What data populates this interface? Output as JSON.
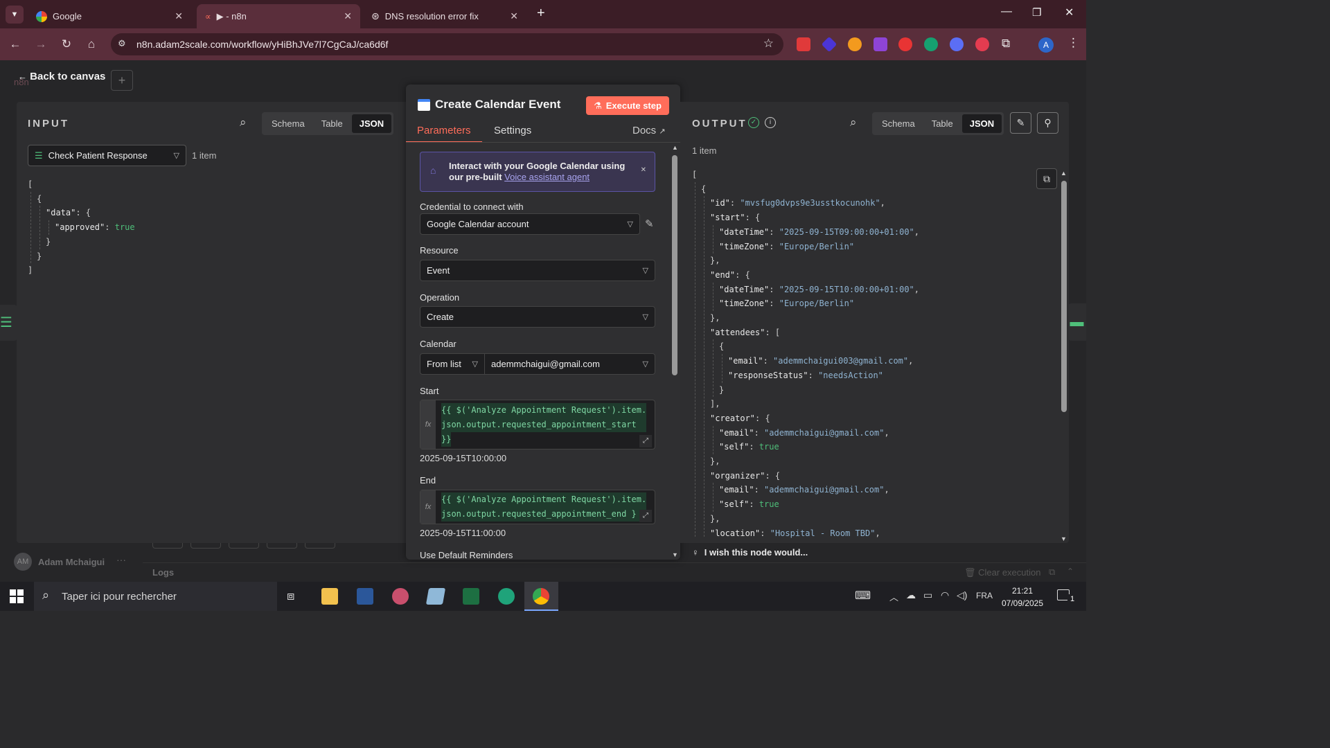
{
  "browser": {
    "tabs": [
      {
        "title": "Google",
        "active": false
      },
      {
        "title": "▶ - n8n",
        "active": true
      },
      {
        "title": "DNS resolution error fix",
        "active": false
      }
    ],
    "url": "n8n.adam2scale.com/workflow/yHiBhJVe7l7CgCaJ/ca6d6f",
    "profile_initial": "A"
  },
  "canvas": {
    "back_label": "Back to canvas",
    "logo_text": "n8n",
    "user_initials": "AM",
    "user_name": "Adam Mchaigui",
    "logs_label": "Logs",
    "clear_execution": "Clear execution"
  },
  "input": {
    "title": "INPUT",
    "views": [
      "Schema",
      "Table",
      "JSON"
    ],
    "active_view": "JSON",
    "node_select": "Check Patient Response",
    "item_count": "1 item"
  },
  "node": {
    "title": "Create Calendar Event",
    "execute_label": "Execute step",
    "tabs": {
      "parameters": "Parameters",
      "settings": "Settings",
      "docs": "Docs"
    },
    "banner_text": "Interact with your Google Calendar using our pre-built",
    "banner_link": "Voice assistant agent",
    "credential_label": "Credential to connect with",
    "credential_value": "Google Calendar account",
    "resource_label": "Resource",
    "resource_value": "Event",
    "operation_label": "Operation",
    "operation_value": "Create",
    "calendar_label": "Calendar",
    "calendar_mode": "From list",
    "calendar_value": "ademmchaigui@gmail.com",
    "start_label": "Start",
    "start_expr_1": "{{ $('Analyze Appointment Request').item.",
    "start_expr_2": "json.output.requested_appointment_start",
    "start_expr_3": "}}",
    "start_result": "2025-09-15T10:00:00",
    "end_label": "End",
    "end_expr_1": "{{ $('Analyze Appointment Request').item.",
    "end_expr_2": "json.output.requested_appointment_end }",
    "end_result": "2025-09-15T11:00:00",
    "reminders_label": "Use Default Reminders"
  },
  "output": {
    "title": "OUTPUT",
    "views": [
      "Schema",
      "Table",
      "JSON"
    ],
    "active_view": "JSON",
    "item_count": "1 item",
    "feedback": "I wish this node would..."
  },
  "taskbar": {
    "search_placeholder": "Taper ici pour rechercher",
    "language": "FRA",
    "time": "21:21",
    "date": "07/09/2025",
    "notifications": "1"
  },
  "colors": {
    "accent": "#ff6d5a",
    "tab_strip": "#3b1d26",
    "toolbar": "#5a2e3b",
    "json_string": "#8fb3d1",
    "json_bool": "#4fbf7a"
  }
}
